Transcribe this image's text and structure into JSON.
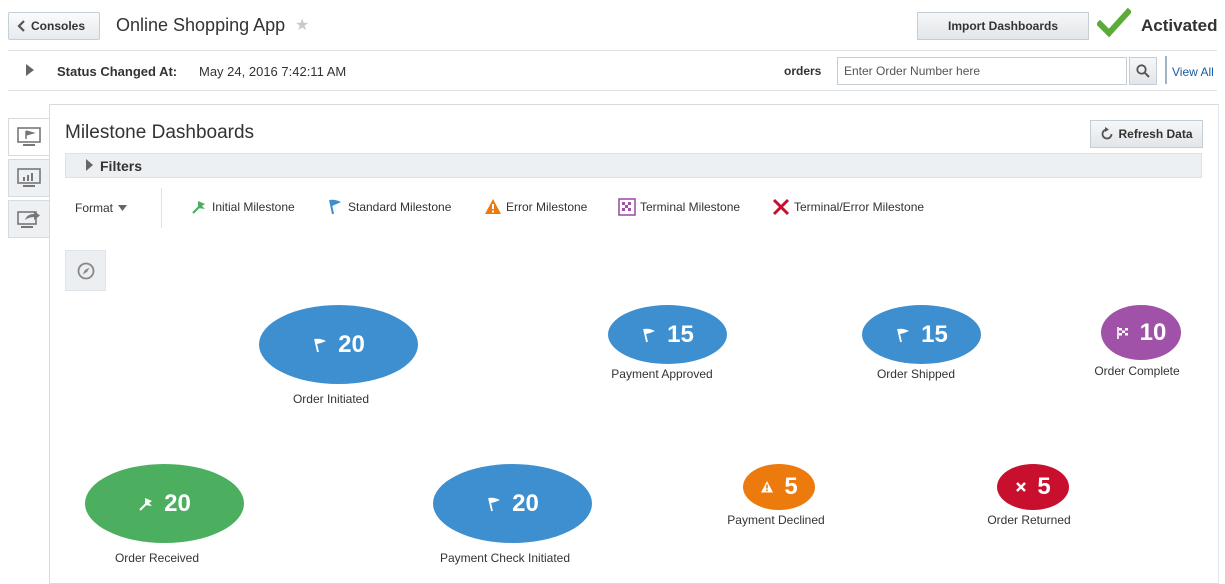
{
  "header": {
    "consoles_label": "Consoles",
    "app_title": "Online Shopping App",
    "import_label": "Import Dashboards",
    "status": "Activated"
  },
  "status_bar": {
    "label": "Status Changed At:",
    "value": "May 24, 2016 7:42:11 AM",
    "orders_label": "orders",
    "order_placeholder": "Enter Order Number here",
    "view_all": "View All"
  },
  "panel": {
    "title": "Milestone Dashboards",
    "refresh_label": "Refresh Data",
    "filters_label": "Filters",
    "format_label": "Format"
  },
  "legend": [
    {
      "label": "Initial Milestone",
      "icon": "initial-milestone-icon",
      "color": "#4caf60"
    },
    {
      "label": "Standard Milestone",
      "icon": "standard-milestone-icon",
      "color": "#3e8fd0"
    },
    {
      "label": "Error Milestone",
      "icon": "error-milestone-icon",
      "color": "#ec7a0c"
    },
    {
      "label": "Terminal Milestone",
      "icon": "terminal-milestone-icon",
      "color": "#a052a8"
    },
    {
      "label": "Terminal/Error Milestone",
      "icon": "terminal-error-milestone-icon",
      "color": "#c8102e"
    }
  ],
  "milestones": [
    {
      "label": "Order Initiated",
      "count": "20",
      "type": "standard"
    },
    {
      "label": "Payment Approved",
      "count": "15",
      "type": "standard"
    },
    {
      "label": "Order Shipped",
      "count": "15",
      "type": "standard"
    },
    {
      "label": "Order Complete",
      "count": "10",
      "type": "terminal"
    },
    {
      "label": "Order Received",
      "count": "20",
      "type": "initial"
    },
    {
      "label": "Payment Check Initiated",
      "count": "20",
      "type": "standard"
    },
    {
      "label": "Payment Declined",
      "count": "5",
      "type": "error"
    },
    {
      "label": "Order Returned",
      "count": "5",
      "type": "terminal-error"
    }
  ]
}
